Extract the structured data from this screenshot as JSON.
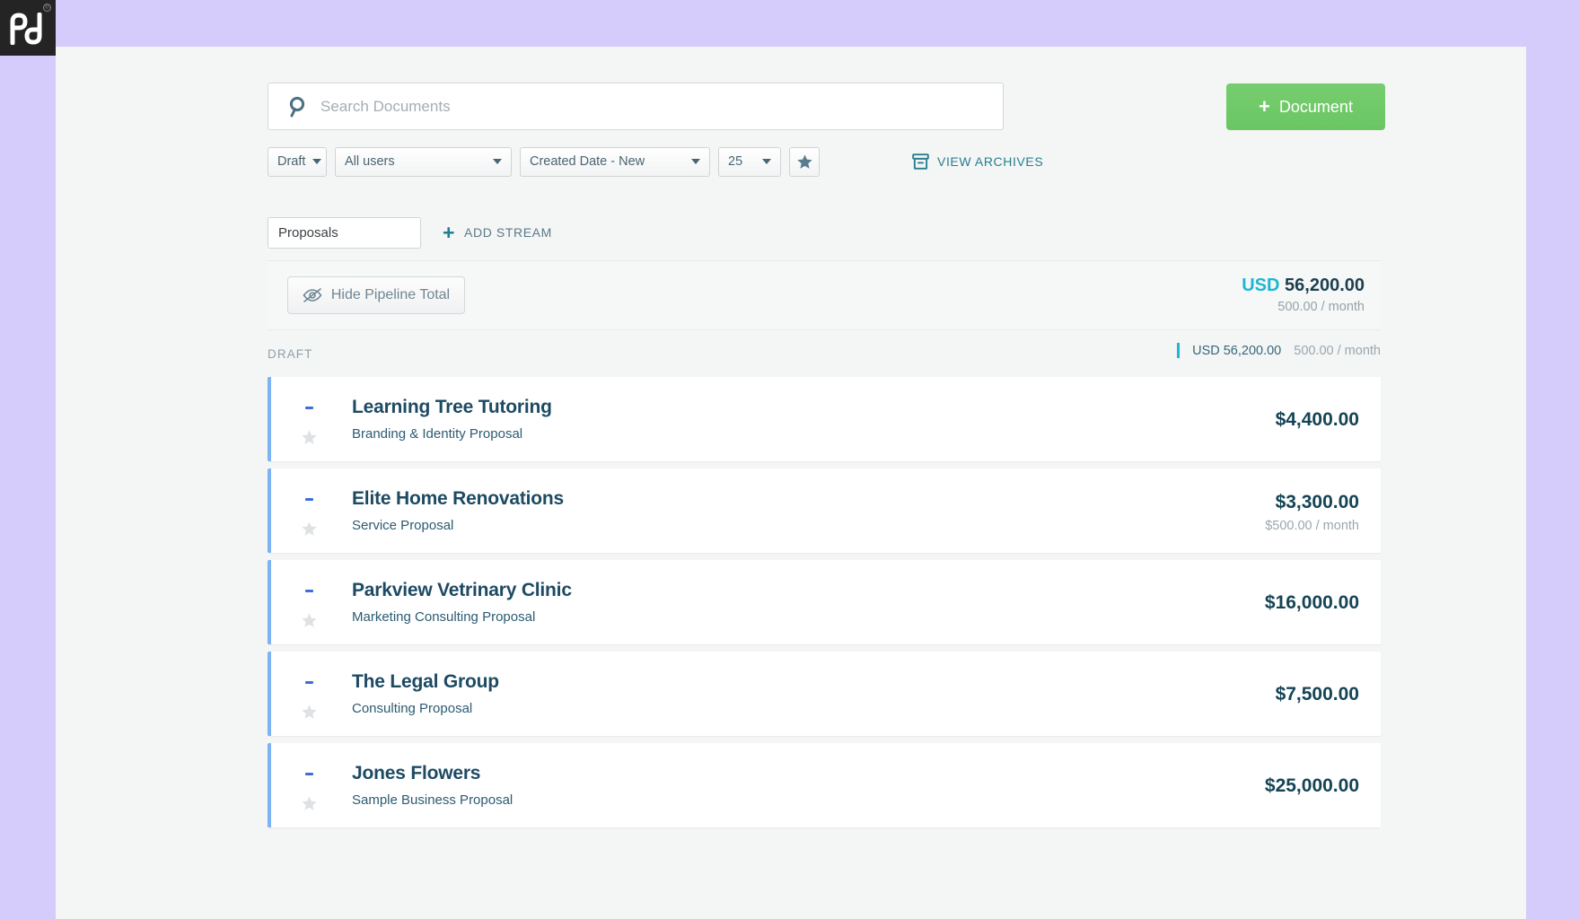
{
  "brand": {
    "logo_name": "pd",
    "registered_mark": "®"
  },
  "search": {
    "placeholder": "Search Documents",
    "value": "",
    "icon": "search-icon"
  },
  "primary_action": {
    "label": "Document",
    "plus": "+",
    "color": "#6ac663"
  },
  "filters": {
    "status": "Draft",
    "users": "All users",
    "sort": "Created Date - New",
    "page_size": "25",
    "favorites_icon": "star-icon"
  },
  "archives": {
    "label": "VIEW ARCHIVES",
    "icon": "archive-box-icon"
  },
  "stream": {
    "name_value": "Proposals",
    "confirm_icon": "check-icon",
    "add_label": "ADD STREAM",
    "add_plus": "+"
  },
  "pipeline": {
    "toggle_label": "Hide Pipeline Total",
    "toggle_icon": "eye-off-icon",
    "currency": "USD",
    "total": "56,200.00",
    "recurring": "500.00 / month"
  },
  "section": {
    "label": "DRAFT",
    "total": "USD 56,200.00",
    "recurring": "500.00 / month"
  },
  "documents": [
    {
      "title": "Learning Tree Tutoring",
      "subtitle": "Branding & Identity Proposal",
      "price": "$4,400.00",
      "recurring": ""
    },
    {
      "title": "Elite Home Renovations",
      "subtitle": "Service Proposal",
      "price": "$3,300.00",
      "recurring": "$500.00 / month"
    },
    {
      "title": "Parkview Vetrinary Clinic",
      "subtitle": "Marketing Consulting Proposal",
      "price": "$16,000.00",
      "recurring": ""
    },
    {
      "title": "The Legal Group",
      "subtitle": "Consulting Proposal",
      "price": "$7,500.00",
      "recurring": ""
    },
    {
      "title": "Jones Flowers",
      "subtitle": "Sample Business Proposal",
      "price": "$25,000.00",
      "recurring": ""
    }
  ]
}
